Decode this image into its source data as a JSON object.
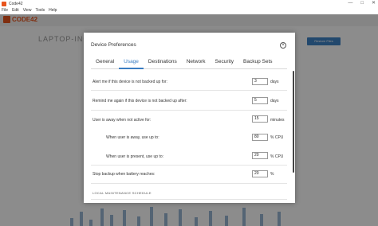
{
  "window": {
    "title": "Code42",
    "controls": [
      "—",
      "□",
      "✕"
    ]
  },
  "menu": [
    "File",
    "Edit",
    "View",
    "Tools",
    "Help"
  ],
  "background": {
    "logo": "CODE42",
    "device_name": "LAPTOP-INC",
    "button": "Restore Files"
  },
  "dialog": {
    "title": "Device Preferences",
    "close_icon": "close-icon",
    "tabs": [
      {
        "label": "General",
        "active": false
      },
      {
        "label": "Usage",
        "active": true
      },
      {
        "label": "Destinations",
        "active": false
      },
      {
        "label": "Network",
        "active": false
      },
      {
        "label": "Security",
        "active": false
      },
      {
        "label": "Backup Sets",
        "active": false
      }
    ],
    "rows": [
      {
        "label": "Alert me if this device is not backed up for:",
        "value": "3",
        "unit": "days"
      },
      {
        "label": "Remind me again if this device is not backed up after:",
        "value": "5",
        "unit": "days"
      },
      {
        "label": "User is away when not active for:",
        "value": "15",
        "unit": "minutes"
      },
      {
        "label": "When user is away, use up to:",
        "value": "80",
        "unit": "% CPU"
      },
      {
        "label": "When user is present, use up to:",
        "value": "20",
        "unit": "% CPU"
      },
      {
        "label": "Stop backup when battery reaches:",
        "value": "20",
        "unit": "%"
      }
    ],
    "section_heading": "LOCAL MAINTENANCE SCHEDULE"
  },
  "colors": {
    "accent": "#3a7dc2",
    "brand": "#e8541c"
  }
}
